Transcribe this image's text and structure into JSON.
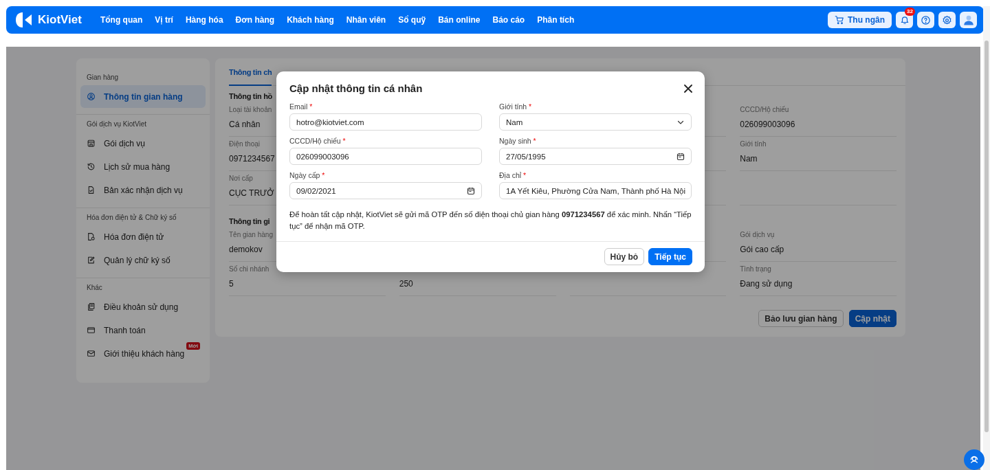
{
  "navbar": {
    "brand": "KiotViet",
    "menu": [
      {
        "label": "Tổng quan"
      },
      {
        "label": "Vị trí"
      },
      {
        "label": "Hàng hóa"
      },
      {
        "label": "Đơn hàng"
      },
      {
        "label": "Khách hàng"
      },
      {
        "label": "Nhân viên"
      },
      {
        "label": "Sổ quỹ"
      },
      {
        "label": "Bán online"
      },
      {
        "label": "Báo cáo"
      },
      {
        "label": "Phân tích"
      }
    ],
    "cashier_button": "Thu ngân",
    "notification_count": "32"
  },
  "sidebar": {
    "groups": [
      {
        "title": "Gian hàng",
        "items": [
          {
            "label": "Thông tin gian hàng",
            "selected": true
          }
        ]
      },
      {
        "title": "Gói dịch vụ KiotViet",
        "items": [
          {
            "label": "Gói dịch vụ",
            "selected": false
          },
          {
            "label": "Lịch sử mua hàng",
            "selected": false
          },
          {
            "label": "Bản xác nhận dịch vụ",
            "selected": false
          }
        ]
      },
      {
        "title": "Hóa đơn điện tử & Chữ ký số",
        "items": [
          {
            "label": "Hóa đơn điện tử",
            "selected": false
          },
          {
            "label": "Quản lý chữ ký số",
            "selected": false
          }
        ]
      },
      {
        "title": "Khác",
        "items": [
          {
            "label": "Điều khoản sử dụng",
            "selected": false
          },
          {
            "label": "Thanh toán",
            "selected": false
          },
          {
            "label": "Giới thiệu khách hàng",
            "selected": false,
            "badge": "Mới"
          }
        ]
      }
    ]
  },
  "main": {
    "tabs": [
      {
        "label": "Thông tin ch",
        "selected": true
      }
    ],
    "sections": [
      {
        "title": "Thông tin hồ",
        "rows": [
          [
            {
              "label": "Loại tài khoản",
              "value": "Cá nhân"
            },
            null,
            null,
            {
              "label": "CCCD/Hộ chiếu",
              "value": "026099003096"
            }
          ],
          [
            {
              "label": "Điện thoại",
              "value": "0971234567"
            },
            null,
            null,
            {
              "label": "Giới tính",
              "value": "Nam"
            }
          ],
          [
            {
              "label": "Nơi cấp",
              "value": "CỤC TRƯỞ"
            },
            null,
            null,
            {}
          ]
        ]
      },
      {
        "title": "Thông tin gi",
        "rows": [
          [
            {
              "label": "Tên gian hàng",
              "value": "demokov"
            },
            null,
            null,
            {
              "label": "Gói dịch vụ",
              "value": "Gói cao cấp"
            }
          ],
          [
            {
              "label": "Số chi nhánh",
              "value": "5"
            },
            {
              "value": "250"
            },
            {},
            {
              "label": "Tình trạng",
              "value": "Đang sử dụng"
            }
          ]
        ]
      }
    ],
    "buttons": [
      {
        "label": "Bảo lưu gian hàng",
        "kind": "secondary"
      },
      {
        "label": "Cập nhật",
        "kind": "primary"
      }
    ]
  },
  "modal": {
    "title": "Cập nhật thông tin cá nhân",
    "fields": [
      {
        "label": "Email",
        "required_mark": "*",
        "value": "hotro@kiotviet.com",
        "kind": "text"
      },
      {
        "label": "Giới tính",
        "required_mark": "*",
        "value": "Nam",
        "kind": "select"
      },
      {
        "label": "CCCD/Hộ chiếu",
        "required_mark": "*",
        "value": "026099003096",
        "kind": "text"
      },
      {
        "label": "Ngày sinh",
        "required_mark": "*",
        "value": "27/05/1995",
        "kind": "date"
      },
      {
        "label": "Ngày cấp",
        "required_mark": "*",
        "value": "09/02/2021",
        "kind": "date"
      },
      {
        "label": "Địa chỉ",
        "required_mark": "*",
        "value": "1A Yết Kiêu, Phường Cửa Nam, Thành phố Hà Nội",
        "kind": "text"
      }
    ],
    "note": "Để hoàn tất cập nhật, KiotViet sẽ gửi mã OTP đến số điện thoại chủ gian hàng **0971234567** để xác minh. Nhấn “Tiếp tục” để nhận mã OTP.",
    "buttons": [
      {
        "label": "Hủy bỏ",
        "kind": "secondary"
      },
      {
        "label": "Tiếp tục",
        "kind": "primary"
      }
    ]
  }
}
